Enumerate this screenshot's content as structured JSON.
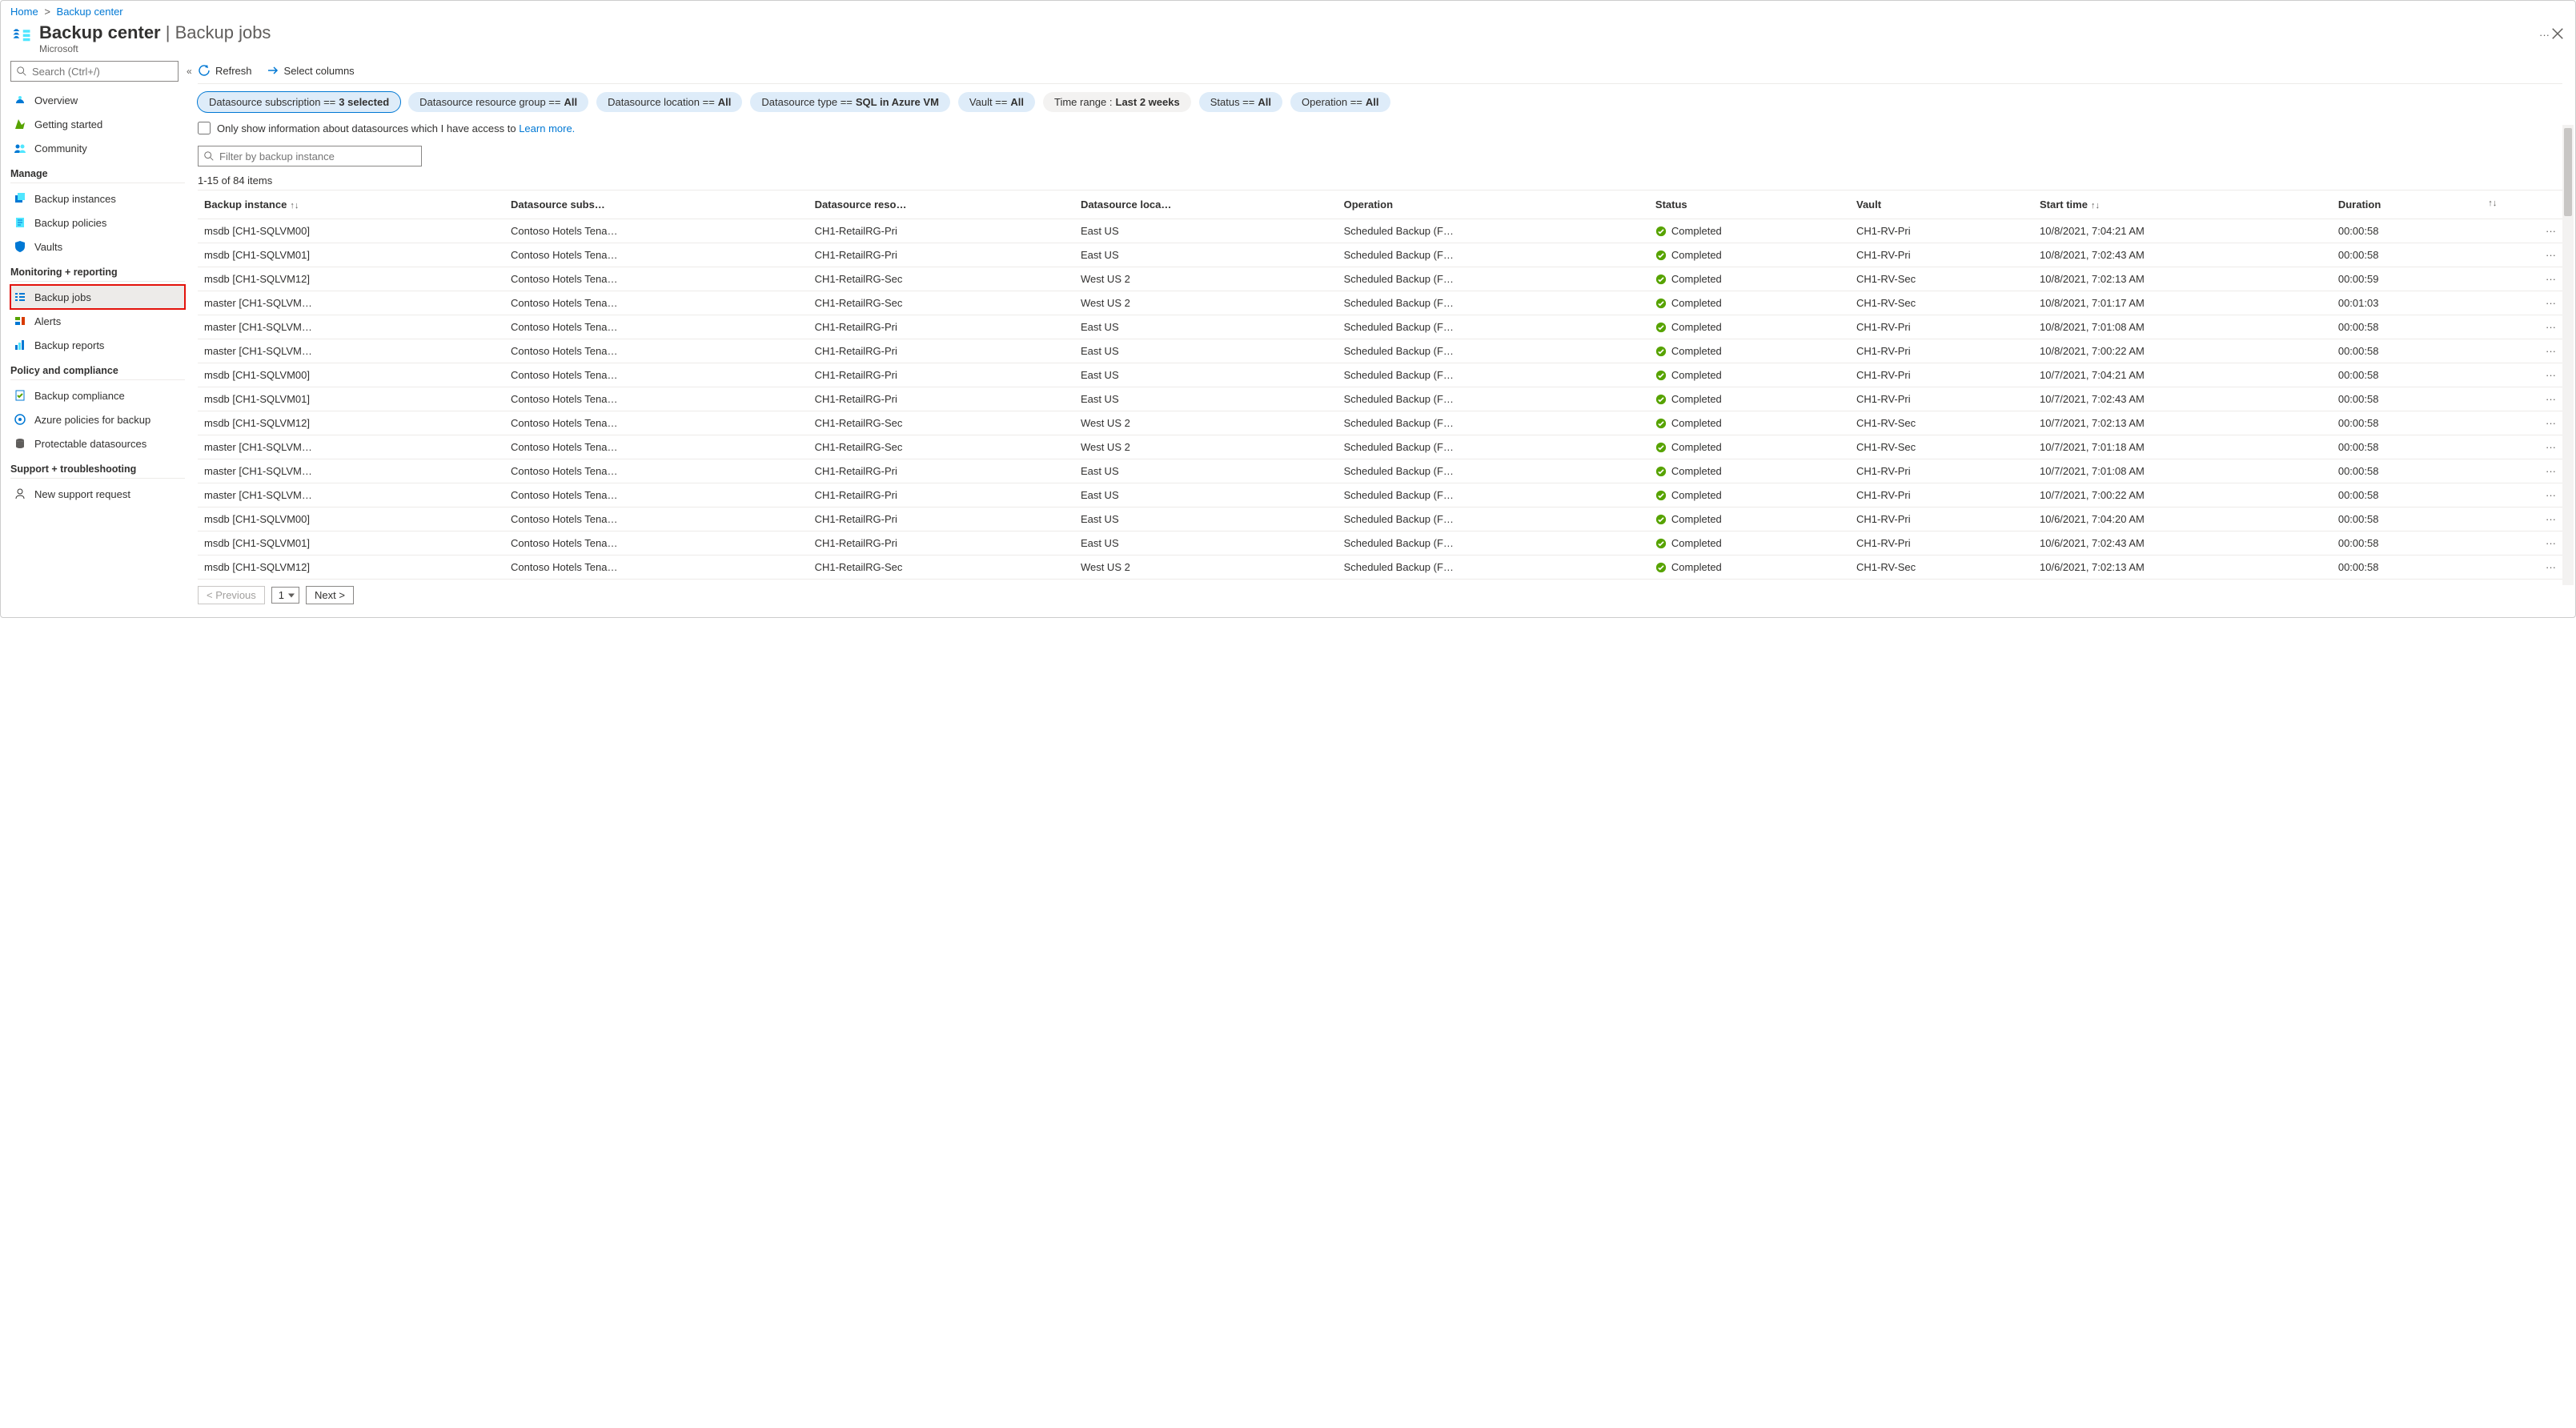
{
  "breadcrumb": {
    "home": "Home",
    "current": "Backup center"
  },
  "header": {
    "title_strong": "Backup center",
    "title_sep": " | ",
    "title_thin": "Backup jobs",
    "subtitle": "Microsoft",
    "more": "···"
  },
  "sidebar": {
    "search_placeholder": "Search (Ctrl+/)",
    "collapse_glyph": "«",
    "general": [
      {
        "id": "overview",
        "label": "Overview"
      },
      {
        "id": "getting",
        "label": "Getting started"
      },
      {
        "id": "community",
        "label": "Community"
      }
    ],
    "section_manage": "Manage",
    "manage": [
      {
        "id": "backup-instances",
        "label": "Backup instances"
      },
      {
        "id": "backup-policies",
        "label": "Backup policies"
      },
      {
        "id": "vaults",
        "label": "Vaults"
      }
    ],
    "section_monitor": "Monitoring + reporting",
    "monitor": [
      {
        "id": "backup-jobs",
        "label": "Backup jobs",
        "selected": true
      },
      {
        "id": "alerts",
        "label": "Alerts"
      },
      {
        "id": "backup-reports",
        "label": "Backup reports"
      }
    ],
    "section_policy": "Policy and compliance",
    "policy": [
      {
        "id": "backup-compliance",
        "label": "Backup compliance"
      },
      {
        "id": "azure-policies",
        "label": "Azure policies for backup"
      },
      {
        "id": "protectable",
        "label": "Protectable datasources"
      }
    ],
    "section_support": "Support + troubleshooting",
    "support": [
      {
        "id": "support-request",
        "label": "New support request"
      }
    ]
  },
  "toolbar": {
    "refresh": "Refresh",
    "select_cols": "Select columns"
  },
  "filters": [
    {
      "prefix": "Datasource subscription == ",
      "value": "3 selected",
      "active": true
    },
    {
      "prefix": "Datasource resource group == ",
      "value": "All"
    },
    {
      "prefix": "Datasource location == ",
      "value": "All"
    },
    {
      "prefix": "Datasource type == ",
      "value": "SQL in Azure VM"
    },
    {
      "prefix": "Vault == ",
      "value": "All"
    },
    {
      "prefix": "Time range : ",
      "value": "Last 2 weeks",
      "alt": true
    },
    {
      "prefix": "Status == ",
      "value": "All"
    },
    {
      "prefix": "Operation == ",
      "value": "All"
    }
  ],
  "access_row": {
    "text": "Only show information about datasources which I have access to ",
    "link": "Learn more."
  },
  "filter_input_placeholder": "Filter by backup instance",
  "count_text": "1-15 of 84 items",
  "columns": {
    "backup_instance": "Backup instance",
    "subscription": "Datasource subs…",
    "resource_group": "Datasource reso…",
    "location": "Datasource loca…",
    "operation": "Operation",
    "status": "Status",
    "vault": "Vault",
    "start_time": "Start time",
    "duration": "Duration",
    "sort_glyph": "↑↓"
  },
  "rows": [
    {
      "inst": "msdb [CH1-SQLVM00]",
      "sub": "Contoso Hotels Tena…",
      "rg": "CH1-RetailRG-Pri",
      "loc": "East US",
      "op": "Scheduled Backup (F…",
      "status": "Completed",
      "vault": "CH1-RV-Pri",
      "start": "10/8/2021, 7:04:21 AM",
      "dur": "00:00:58"
    },
    {
      "inst": "msdb [CH1-SQLVM01]",
      "sub": "Contoso Hotels Tena…",
      "rg": "CH1-RetailRG-Pri",
      "loc": "East US",
      "op": "Scheduled Backup (F…",
      "status": "Completed",
      "vault": "CH1-RV-Pri",
      "start": "10/8/2021, 7:02:43 AM",
      "dur": "00:00:58"
    },
    {
      "inst": "msdb [CH1-SQLVM12]",
      "sub": "Contoso Hotels Tena…",
      "rg": "CH1-RetailRG-Sec",
      "loc": "West US 2",
      "op": "Scheduled Backup (F…",
      "status": "Completed",
      "vault": "CH1-RV-Sec",
      "start": "10/8/2021, 7:02:13 AM",
      "dur": "00:00:59"
    },
    {
      "inst": "master [CH1-SQLVM…",
      "sub": "Contoso Hotels Tena…",
      "rg": "CH1-RetailRG-Sec",
      "loc": "West US 2",
      "op": "Scheduled Backup (F…",
      "status": "Completed",
      "vault": "CH1-RV-Sec",
      "start": "10/8/2021, 7:01:17 AM",
      "dur": "00:01:03"
    },
    {
      "inst": "master [CH1-SQLVM…",
      "sub": "Contoso Hotels Tena…",
      "rg": "CH1-RetailRG-Pri",
      "loc": "East US",
      "op": "Scheduled Backup (F…",
      "status": "Completed",
      "vault": "CH1-RV-Pri",
      "start": "10/8/2021, 7:01:08 AM",
      "dur": "00:00:58"
    },
    {
      "inst": "master [CH1-SQLVM…",
      "sub": "Contoso Hotels Tena…",
      "rg": "CH1-RetailRG-Pri",
      "loc": "East US",
      "op": "Scheduled Backup (F…",
      "status": "Completed",
      "vault": "CH1-RV-Pri",
      "start": "10/8/2021, 7:00:22 AM",
      "dur": "00:00:58"
    },
    {
      "inst": "msdb [CH1-SQLVM00]",
      "sub": "Contoso Hotels Tena…",
      "rg": "CH1-RetailRG-Pri",
      "loc": "East US",
      "op": "Scheduled Backup (F…",
      "status": "Completed",
      "vault": "CH1-RV-Pri",
      "start": "10/7/2021, 7:04:21 AM",
      "dur": "00:00:58"
    },
    {
      "inst": "msdb [CH1-SQLVM01]",
      "sub": "Contoso Hotels Tena…",
      "rg": "CH1-RetailRG-Pri",
      "loc": "East US",
      "op": "Scheduled Backup (F…",
      "status": "Completed",
      "vault": "CH1-RV-Pri",
      "start": "10/7/2021, 7:02:43 AM",
      "dur": "00:00:58"
    },
    {
      "inst": "msdb [CH1-SQLVM12]",
      "sub": "Contoso Hotels Tena…",
      "rg": "CH1-RetailRG-Sec",
      "loc": "West US 2",
      "op": "Scheduled Backup (F…",
      "status": "Completed",
      "vault": "CH1-RV-Sec",
      "start": "10/7/2021, 7:02:13 AM",
      "dur": "00:00:58"
    },
    {
      "inst": "master [CH1-SQLVM…",
      "sub": "Contoso Hotels Tena…",
      "rg": "CH1-RetailRG-Sec",
      "loc": "West US 2",
      "op": "Scheduled Backup (F…",
      "status": "Completed",
      "vault": "CH1-RV-Sec",
      "start": "10/7/2021, 7:01:18 AM",
      "dur": "00:00:58"
    },
    {
      "inst": "master [CH1-SQLVM…",
      "sub": "Contoso Hotels Tena…",
      "rg": "CH1-RetailRG-Pri",
      "loc": "East US",
      "op": "Scheduled Backup (F…",
      "status": "Completed",
      "vault": "CH1-RV-Pri",
      "start": "10/7/2021, 7:01:08 AM",
      "dur": "00:00:58"
    },
    {
      "inst": "master [CH1-SQLVM…",
      "sub": "Contoso Hotels Tena…",
      "rg": "CH1-RetailRG-Pri",
      "loc": "East US",
      "op": "Scheduled Backup (F…",
      "status": "Completed",
      "vault": "CH1-RV-Pri",
      "start": "10/7/2021, 7:00:22 AM",
      "dur": "00:00:58"
    },
    {
      "inst": "msdb [CH1-SQLVM00]",
      "sub": "Contoso Hotels Tena…",
      "rg": "CH1-RetailRG-Pri",
      "loc": "East US",
      "op": "Scheduled Backup (F…",
      "status": "Completed",
      "vault": "CH1-RV-Pri",
      "start": "10/6/2021, 7:04:20 AM",
      "dur": "00:00:58"
    },
    {
      "inst": "msdb [CH1-SQLVM01]",
      "sub": "Contoso Hotels Tena…",
      "rg": "CH1-RetailRG-Pri",
      "loc": "East US",
      "op": "Scheduled Backup (F…",
      "status": "Completed",
      "vault": "CH1-RV-Pri",
      "start": "10/6/2021, 7:02:43 AM",
      "dur": "00:00:58"
    },
    {
      "inst": "msdb [CH1-SQLVM12]",
      "sub": "Contoso Hotels Tena…",
      "rg": "CH1-RetailRG-Sec",
      "loc": "West US 2",
      "op": "Scheduled Backup (F…",
      "status": "Completed",
      "vault": "CH1-RV-Sec",
      "start": "10/6/2021, 7:02:13 AM",
      "dur": "00:00:58"
    }
  ],
  "pager": {
    "prev": "< Previous",
    "current": "1",
    "next": "Next >"
  },
  "more_glyph": "···"
}
